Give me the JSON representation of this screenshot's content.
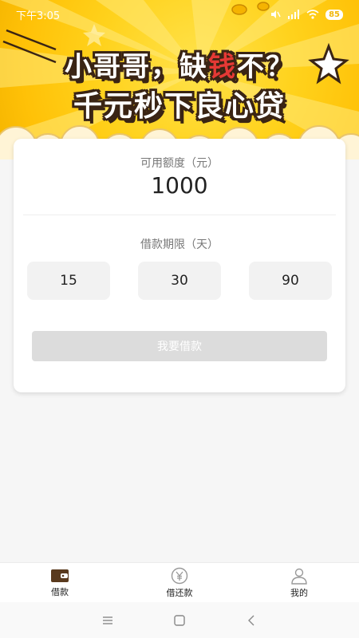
{
  "status": {
    "time": "下午3:05",
    "battery": "85"
  },
  "banner": {
    "line1_a": "小哥哥，缺",
    "line1_accent": "钱",
    "line1_b": "不？",
    "line2": "千元秒下良心贷"
  },
  "card": {
    "amount_label": "可用额度（元）",
    "amount": "1000",
    "term_label": "借款期限（天）",
    "terms": [
      "15",
      "30",
      "90"
    ],
    "apply_label": "我要借款"
  },
  "tabs": [
    {
      "label": "借款",
      "icon": "wallet-icon"
    },
    {
      "label": "借还款",
      "icon": "yen-circle-icon"
    },
    {
      "label": "我的",
      "icon": "user-icon"
    }
  ],
  "system_nav": {
    "icons": [
      "menu-icon",
      "home-square-icon",
      "back-icon"
    ]
  },
  "colors": {
    "banner_yellow": "#ffd21c",
    "accent_red": "#e53935",
    "outline_brown": "#3a2414",
    "disabled_button": "#dcdcdc"
  }
}
